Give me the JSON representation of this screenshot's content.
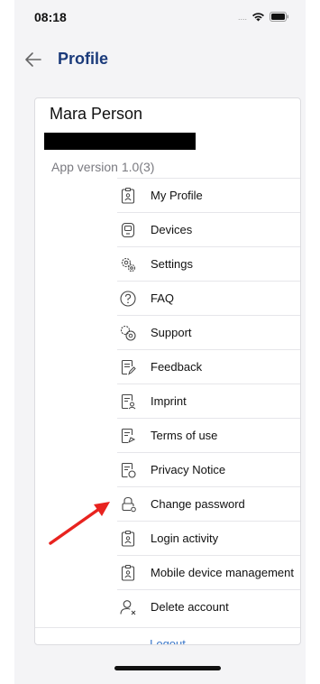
{
  "status_bar": {
    "time": "08:18",
    "icons": [
      "cellular-dots-icon",
      "wifi-icon",
      "battery-icon"
    ]
  },
  "header": {
    "title": "Profile",
    "back_icon": "arrow-left-icon"
  },
  "profile": {
    "name": "Mara Person",
    "app_version": "App version 1.0(3)"
  },
  "menu": {
    "items": [
      {
        "label": "My Profile",
        "icon": "id-badge-icon"
      },
      {
        "label": "Devices",
        "icon": "device-icon"
      },
      {
        "label": "Settings",
        "icon": "gears-icon"
      },
      {
        "label": "FAQ",
        "icon": "question-circle-icon"
      },
      {
        "label": "Support",
        "icon": "support-icon"
      },
      {
        "label": "Feedback",
        "icon": "feedback-icon"
      },
      {
        "label": "Imprint",
        "icon": "imprint-icon"
      },
      {
        "label": "Terms of use",
        "icon": "terms-icon"
      },
      {
        "label": "Privacy Notice",
        "icon": "privacy-icon"
      },
      {
        "label": "Change password",
        "icon": "lock-icon"
      },
      {
        "label": "Login activity",
        "icon": "id-badge-icon"
      },
      {
        "label": "Mobile device management",
        "icon": "id-badge-icon"
      },
      {
        "label": "Delete account",
        "icon": "user-remove-icon"
      }
    ],
    "logout_label": "Logout"
  },
  "colors": {
    "title": "#1a3a7a",
    "link": "#3a77c9",
    "annotation_arrow": "#e8231f"
  }
}
